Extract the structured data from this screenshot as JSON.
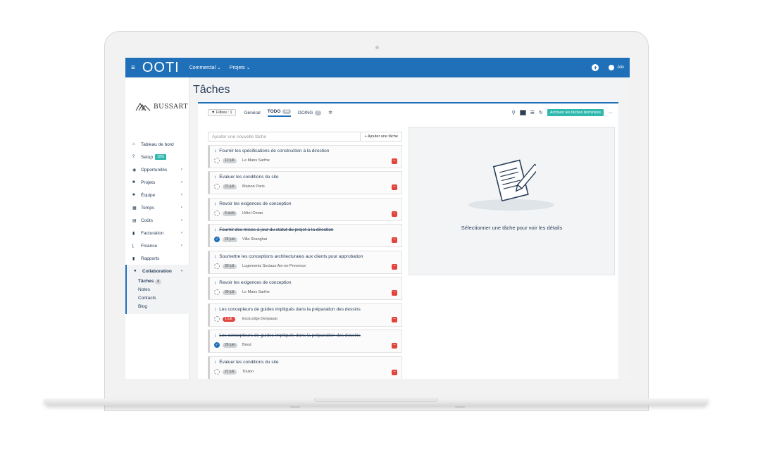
{
  "app": {
    "logo": "OOTI",
    "menu_icon": "hamburger-icon"
  },
  "topnav": {
    "items": [
      "Commercial ⌄",
      "Projets ⌄"
    ],
    "user": "Alix"
  },
  "company": "BUSSART",
  "page_title": "Tâches",
  "sidebar": {
    "items": [
      {
        "label": "Tableau de bord",
        "icon": "home-icon",
        "arrow": ""
      },
      {
        "label": "Setup",
        "icon": "question-icon",
        "badge": "10%",
        "arrow": ""
      },
      {
        "label": "Opportunités",
        "icon": "eye-icon",
        "arrow": "‹"
      },
      {
        "label": "Projets",
        "icon": "folder-icon",
        "arrow": "‹"
      },
      {
        "label": "Équipe",
        "icon": "team-icon",
        "arrow": "‹"
      },
      {
        "label": "Temps",
        "icon": "calendar-icon",
        "arrow": "‹"
      },
      {
        "label": "Coûts",
        "icon": "money-icon",
        "arrow": "‹"
      },
      {
        "label": "Facturation",
        "icon": "invoice-icon",
        "arrow": "‹"
      },
      {
        "label": "Finance",
        "icon": "chart-icon",
        "arrow": "‹"
      },
      {
        "label": "Rapports",
        "icon": "report-icon",
        "arrow": ""
      }
    ],
    "collaboration": {
      "label": "Collaboration",
      "arrow": "‹",
      "subitems": [
        {
          "label": "Tâches",
          "count": "8"
        },
        {
          "label": "Notes"
        },
        {
          "label": "Contacts"
        },
        {
          "label": "Blog"
        }
      ]
    }
  },
  "toolbar": {
    "filters": "Filtres : 1",
    "tabs": [
      {
        "label": "Général"
      },
      {
        "label": "TODO",
        "count": "15"
      },
      {
        "label": "DOING",
        "count": "7"
      }
    ],
    "archive_label": "Archiver les tâches terminées",
    "more": "···"
  },
  "add_task": {
    "placeholder": "Ajouter une nouvelle tâche",
    "button": "+ Ajouter une tâche"
  },
  "tasks": [
    {
      "title": "Fournir les spécifications de construction à la direction",
      "date": "12 juil.",
      "project": "Le Mans Sarthe",
      "done": false,
      "late": false
    },
    {
      "title": "Évaluer les conditions du site",
      "date": "21 juil.",
      "project": "Maison Paris",
      "done": false,
      "late": false
    },
    {
      "title": "Revoir les exigences de conception",
      "date": "4 août",
      "project": "Hôtel Oman",
      "done": false,
      "late": false
    },
    {
      "title": "Fournir des mises à jour du statut du projet à la direction",
      "date": "25 juin",
      "project": "Villa Shanghai",
      "done": true,
      "late": false
    },
    {
      "title": "Soumettre les conceptions architecturales aux clients pour approbation",
      "date": "30 juil.",
      "project": "Logements Sociaux Aix-en-Provence",
      "done": false,
      "late": false
    },
    {
      "title": "Revoir les exigences de conception",
      "date": "30 juil.",
      "project": "Le Mans Sarthe",
      "done": false,
      "late": false
    },
    {
      "title": "Les concepteurs de guides impliqués dans la préparation des dessins",
      "date": "1 juil.",
      "project": "EcoLodge Denpasar",
      "done": false,
      "late": true
    },
    {
      "title": "Les concepteurs de guides impliqués dans la préparation des dessins",
      "date": "28 juin",
      "project": "Brest",
      "done": true,
      "late": false
    },
    {
      "title": "Évaluer les conditions du site",
      "date": "21 juil.",
      "project": "Toulon",
      "done": false,
      "late": false
    }
  ],
  "detail": {
    "message": "Sélectionner une tâche pour voir les détails"
  },
  "colors": {
    "primary": "#1f70b8",
    "teal": "#2fb8ae",
    "danger": "#e0443a"
  }
}
